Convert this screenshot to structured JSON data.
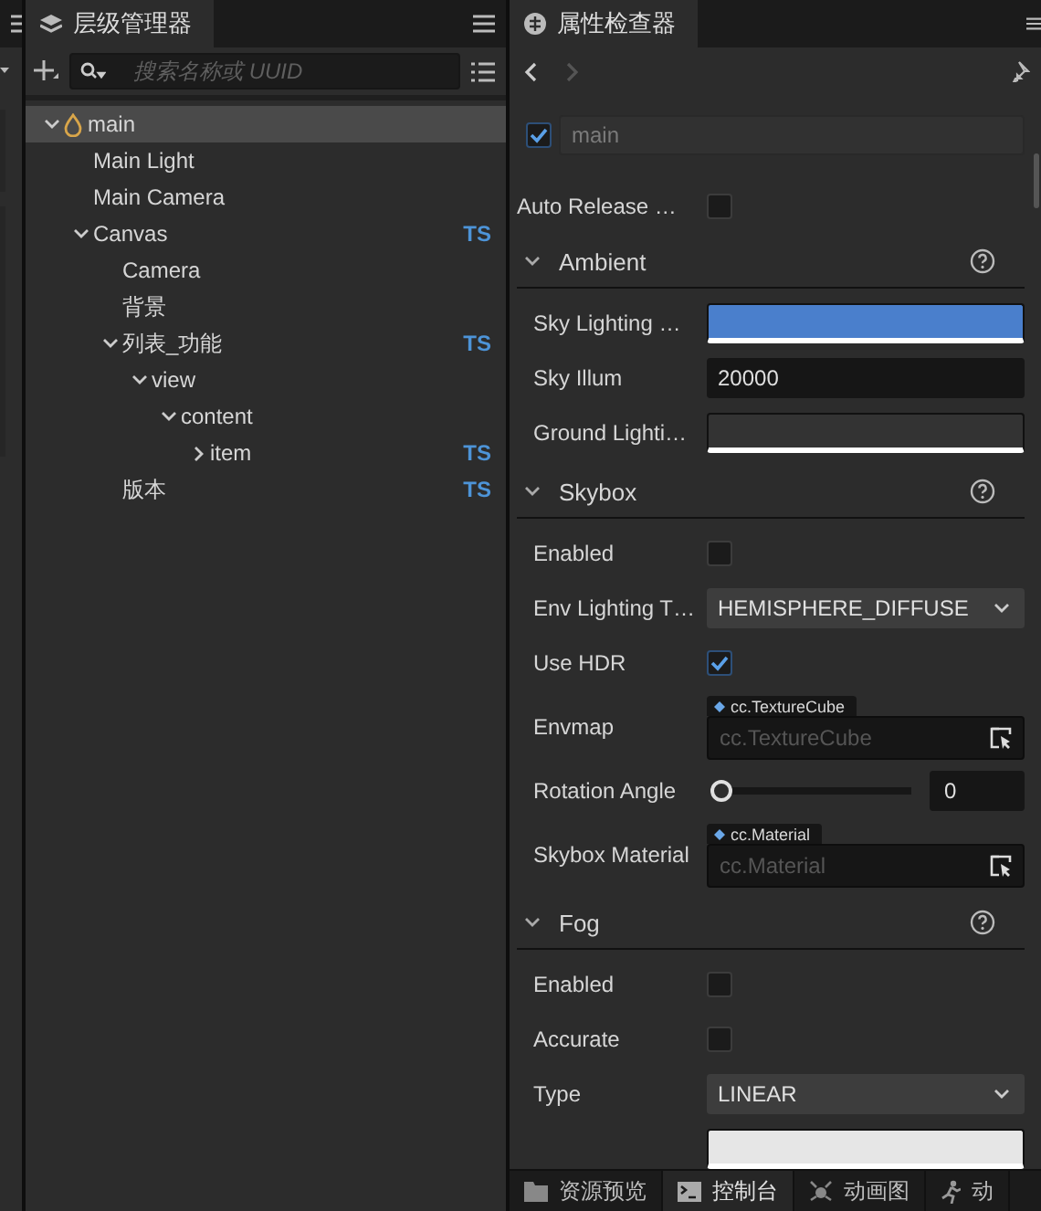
{
  "hierarchy": {
    "title": "层级管理器",
    "search": {
      "placeholder": "搜索名称或 UUID"
    },
    "tree": [
      {
        "label": "main",
        "kind": "scene",
        "expanded": true,
        "selected": true,
        "children": [
          {
            "label": "Main Light",
            "selected": false
          },
          {
            "label": "Main Camera",
            "selected": false
          },
          {
            "label": "Canvas",
            "badge": "TS",
            "expanded": true,
            "selected": false,
            "children": [
              {
                "label": "Camera",
                "selected": false
              },
              {
                "label": "背景",
                "selected": false
              },
              {
                "label": "列表_功能",
                "badge": "TS",
                "expanded": true,
                "selected": false,
                "children": [
                  {
                    "label": "view",
                    "expanded": true,
                    "selected": false,
                    "children": [
                      {
                        "label": "content",
                        "expanded": true,
                        "selected": false,
                        "children": [
                          {
                            "label": "item",
                            "badge": "TS",
                            "expanded": false,
                            "selected": false
                          }
                        ]
                      }
                    ]
                  }
                ]
              },
              {
                "label": "版本",
                "badge": "TS",
                "selected": false
              }
            ]
          }
        ]
      }
    ]
  },
  "inspector": {
    "title": "属性检查器",
    "node": {
      "enabled": true,
      "name": "main"
    },
    "props": [
      {
        "kind": "checkbox",
        "label": "Auto Release …",
        "checked": false
      }
    ],
    "sections": [
      {
        "title": "Ambient",
        "expanded": true,
        "rows": [
          {
            "kind": "color",
            "label": "Sky Lighting …",
            "color": "#4a7fcc"
          },
          {
            "kind": "number",
            "label": "Sky Illum",
            "value": "20000"
          },
          {
            "kind": "color",
            "label": "Ground Lighti…",
            "color": "#333333"
          }
        ]
      },
      {
        "title": "Skybox",
        "expanded": true,
        "rows": [
          {
            "kind": "checkbox",
            "label": "Enabled",
            "checked": false
          },
          {
            "kind": "select",
            "label": "Env Lighting T…",
            "value": "HEMISPHERE_DIFFUSE"
          },
          {
            "kind": "checkbox",
            "label": "Use HDR",
            "checked": true
          },
          {
            "kind": "asset",
            "label": "Envmap",
            "type_tag": "cc.TextureCube",
            "placeholder": "cc.TextureCube"
          },
          {
            "kind": "slider",
            "label": "Rotation Angle",
            "level": 0,
            "value": "0"
          },
          {
            "kind": "asset",
            "label": "Skybox Material",
            "type_tag": "cc.Material",
            "placeholder": "cc.Material"
          }
        ]
      },
      {
        "title": "Fog",
        "expanded": true,
        "rows": [
          {
            "kind": "checkbox",
            "label": "Enabled",
            "checked": false
          },
          {
            "kind": "checkbox",
            "label": "Accurate",
            "checked": false
          },
          {
            "kind": "select",
            "label": "Type",
            "value": "LINEAR"
          },
          {
            "kind": "color",
            "color": "#e6e6e6"
          }
        ]
      }
    ]
  },
  "bottom_tabs": [
    {
      "kind": "folder",
      "label": "资源预览",
      "selected": false
    },
    {
      "kind": "terminal",
      "label": "控制台",
      "selected": true
    },
    {
      "kind": "graph",
      "label": "动画图",
      "selected": false
    },
    {
      "kind": "runner",
      "label": "动",
      "selected": false
    }
  ]
}
